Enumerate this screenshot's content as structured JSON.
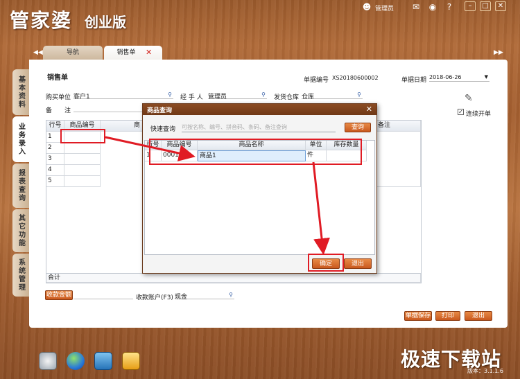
{
  "app": {
    "title": "管家婆",
    "edition": "创业版",
    "user": "管理员",
    "version": "版本：3.1.1.6"
  },
  "tabs": [
    {
      "label": "导航"
    },
    {
      "label": "销售单"
    }
  ],
  "side_tabs": [
    "基本资料",
    "业务录入",
    "报表查询",
    "其它功能",
    "系统管理"
  ],
  "form": {
    "title": "销售单",
    "doc_no_label": "单据编号",
    "doc_no": "XS20180600002",
    "doc_date_label": "单据日期",
    "doc_date": "2018-06-26",
    "buyer_label": "购买单位",
    "buyer": "客户1",
    "handler_label": "经 手 人",
    "handler": "管理员",
    "warehouse_label": "发货仓库",
    "warehouse": "仓库",
    "remark_label": "备　　注",
    "continuous_label": "连续开单",
    "sum_label": "合计",
    "receive_amount_label": "收款金额",
    "account_label": "收款账户(F3)",
    "account": "现金"
  },
  "grid": {
    "headers": [
      "行号",
      "商品编号",
      "商",
      "备注"
    ],
    "rows": [
      "1",
      "2",
      "3",
      "4",
      "5"
    ]
  },
  "dialog": {
    "title": "商品查询",
    "search_label": "快速查询",
    "search_placeholder": "可按名称、编号、拼音码、条码、备注查询",
    "search_button": "查询",
    "headers": [
      "行号",
      "商品编号",
      "商品名称",
      "单位",
      "库存数量"
    ],
    "rows": [
      {
        "no": "1",
        "code": "0001",
        "name": "商品1",
        "unit": "件",
        "stock": ""
      }
    ],
    "ok_button": "确定",
    "exit_button": "退出"
  },
  "actions": {
    "save": "单据保存",
    "print": "打印",
    "exit": "退出"
  },
  "watermark": "极速下载站",
  "colors": {
    "wood": "#a45f30",
    "accent_orange": "#d86a2c",
    "annotation_red": "#e01b24"
  }
}
